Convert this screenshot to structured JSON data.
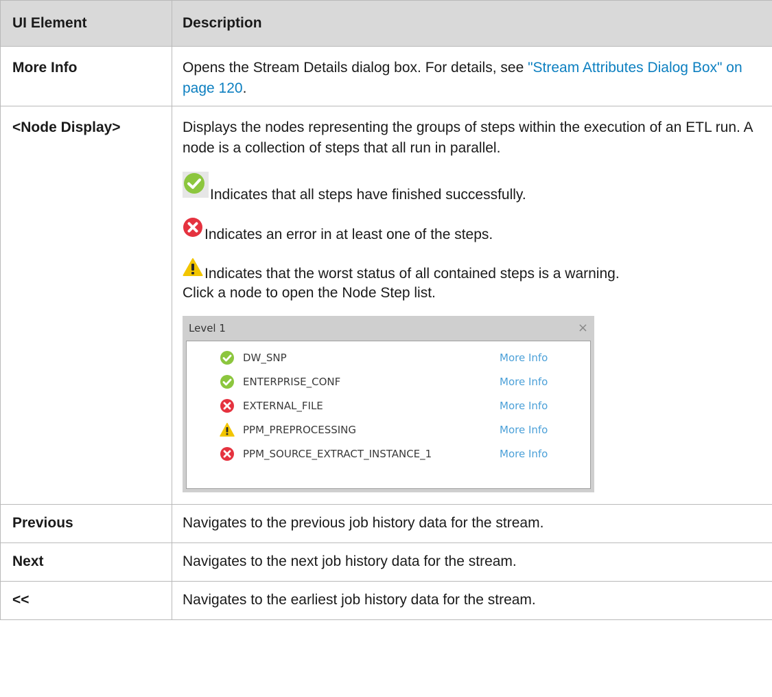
{
  "table": {
    "headers": {
      "element": "UI Element",
      "description": "Description"
    },
    "rows": {
      "more_info": {
        "element": "More Info",
        "desc_prefix": "Opens the Stream Details dialog box. For details, see ",
        "desc_link": "\"Stream Attributes Dialog Box\" on page 120",
        "desc_suffix": "."
      },
      "node_display": {
        "element": "<Node Display>",
        "desc_intro": "Displays the nodes representing the groups of steps within the execution of an ETL run. A node is a collection of steps that all run in parallel.",
        "status_success": {
          "icon": "success-check-icon",
          "text": "Indicates that all steps have finished successfully."
        },
        "status_error": {
          "icon": "error-x-icon",
          "text": "Indicates an error in at least one of the steps."
        },
        "status_warning": {
          "icon": "warning-triangle-icon",
          "text": "Indicates that the worst status of all contained steps is a warning."
        },
        "click_hint": "Click a node to open the Node Step list.",
        "panel": {
          "title": "Level 1",
          "close_glyph": "×",
          "steps": [
            {
              "status": "success",
              "name": "DW_SNP",
              "link": "More Info"
            },
            {
              "status": "success",
              "name": "ENTERPRISE_CONF",
              "link": "More Info"
            },
            {
              "status": "error",
              "name": "EXTERNAL_FILE",
              "link": "More Info"
            },
            {
              "status": "warning",
              "name": "PPM_PREPROCESSING",
              "link": "More Info"
            },
            {
              "status": "error",
              "name": "PPM_SOURCE_EXTRACT_INSTANCE_1",
              "link": "More Info"
            }
          ]
        }
      },
      "previous": {
        "element": "Previous",
        "desc": "Navigates to the previous job history data for the stream."
      },
      "next": {
        "element": "Next",
        "desc": "Navigates to the next job history data for the stream."
      },
      "earliest": {
        "element": "<<",
        "desc": "Navigates to the earliest job history data for the stream."
      }
    }
  },
  "colors": {
    "header_bg": "#d9d9d9",
    "link": "#0c7fc0",
    "success": "#8cc63e",
    "error": "#e5323f",
    "warning": "#f2c500"
  }
}
